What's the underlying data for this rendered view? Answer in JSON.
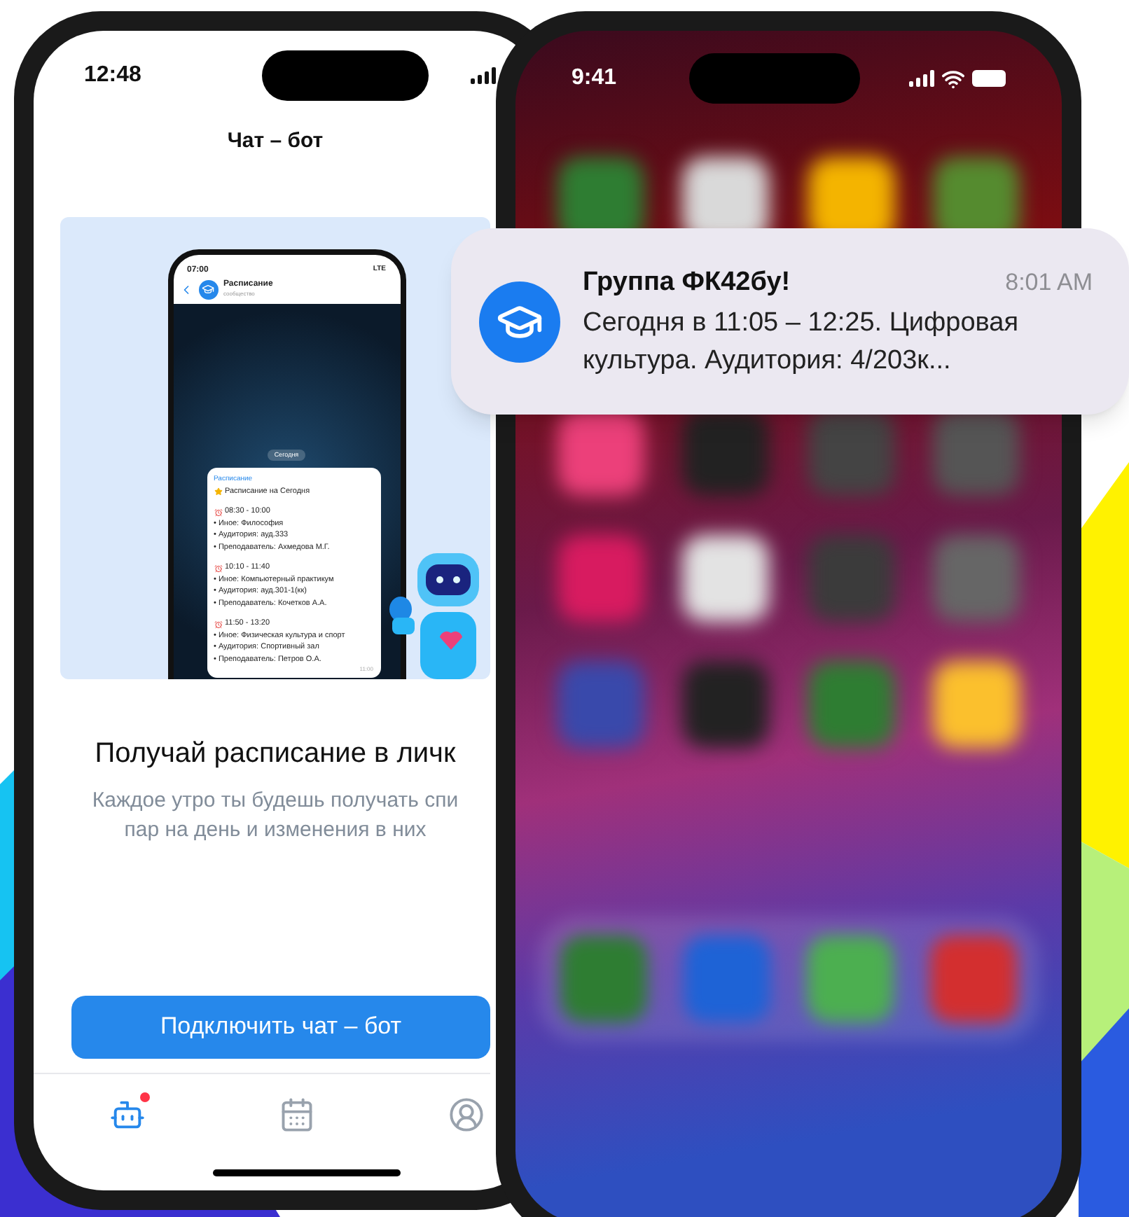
{
  "left_phone": {
    "status_bar": {
      "time": "12:48"
    },
    "title": "Чат – бот",
    "preview": {
      "status_time": "07:00",
      "network": "LTE",
      "chat_name": "Расписание",
      "chat_subtitle": "сообщество",
      "date_chip": "Сегодня",
      "message": {
        "sender": "Расписание",
        "heading": "Расписание на Сегодня",
        "time": "11:00",
        "lessons": [
          {
            "time": "08:30 - 10:00",
            "lines": [
              "• Иное: Философия",
              "• Аудитория: ауд.333",
              "• Преподаватель: Ахмедова М.Г."
            ]
          },
          {
            "time": "10:10 - 11:40",
            "lines": [
              "• Иное: Компьютерный практикум",
              "• Аудитория: ауд.301-1(кк)",
              "• Преподаватель: Кочетков А.А."
            ]
          },
          {
            "time": "11:50 - 13:20",
            "lines": [
              "• Иное: Физическая культура и спорт",
              "• Аудитория: Спортивный зал",
              "• Преподаватель: Петров О.А."
            ]
          }
        ]
      }
    },
    "heading": "Получай расписание в личк",
    "description_lines": [
      "Каждое утро ты будешь получать спи",
      "пар на день и изменения в них"
    ],
    "button": "Подключить чат – бот",
    "tabs": [
      {
        "kind": "robot",
        "selected": true,
        "badge": true
      },
      {
        "kind": "calendar",
        "selected": false,
        "badge": false
      },
      {
        "kind": "profile",
        "selected": false,
        "badge": false
      }
    ]
  },
  "right_phone": {
    "status_bar": {
      "time": "9:41"
    }
  },
  "notification": {
    "title": "Группа ФК42бу!",
    "time": "8:01 AM",
    "body": "Сегодня в 11:05 – 12:25. Цифровая культура. Аудитория: 4/203к..."
  }
}
